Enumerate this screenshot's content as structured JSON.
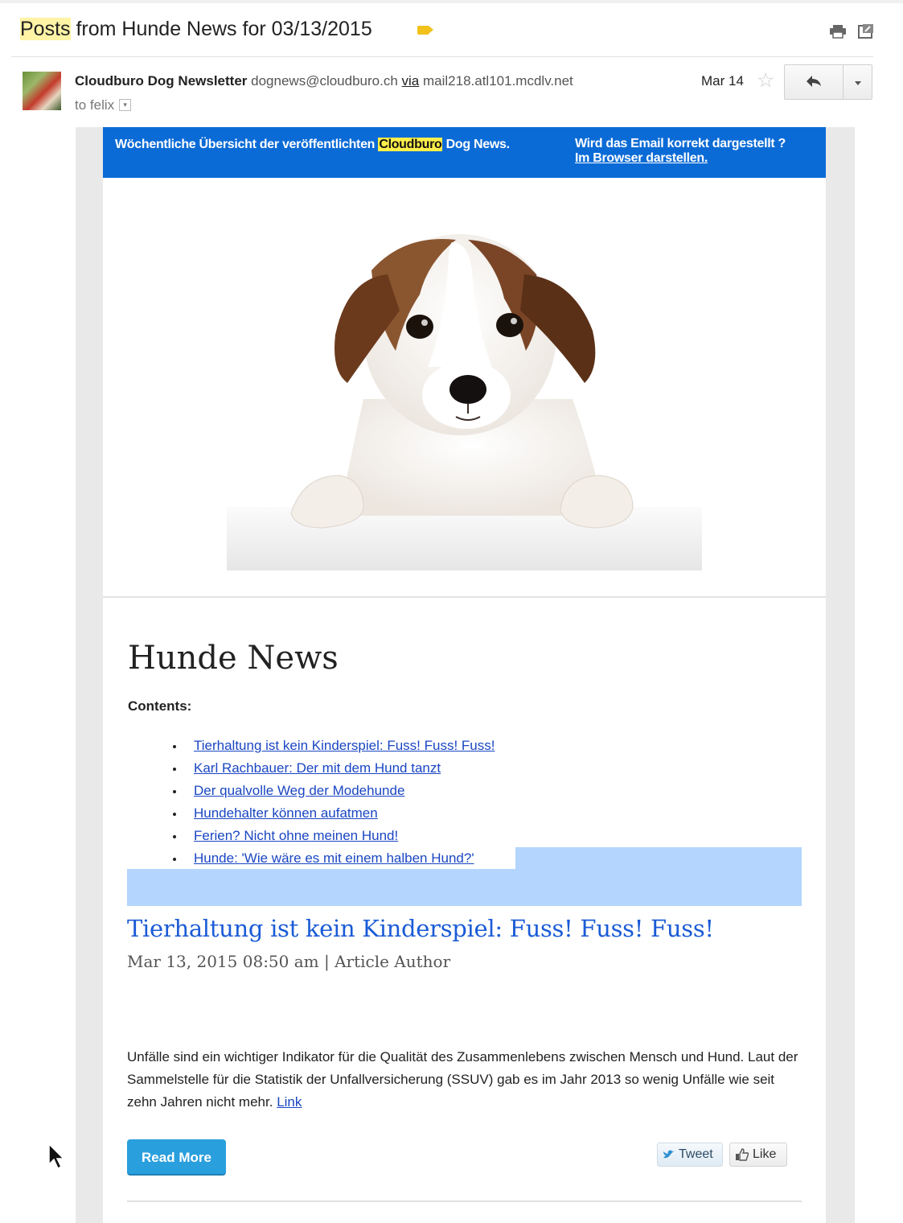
{
  "email": {
    "subject_highlight": "Posts",
    "subject_rest": " from Hunde News for 03/13/2015",
    "sender_name": "Cloudburo Dog Newsletter",
    "sender_address": "dognews@cloudburo.ch",
    "via_label": "via",
    "via_server": "mail218.atl101.mcdlv.net",
    "to_label": "to felix",
    "date": "Mar 14",
    "label_color": "#f2c21b"
  },
  "newsletter": {
    "header_left_pre": "Wöchentliche Übersicht der veröffentlichten ",
    "header_left_highlight": "Cloudburo",
    "header_left_post": " Dog News.",
    "header_right_line1": "Wird das Email korrekt dargestellt ?",
    "header_right_link": "Im Browser darstellen.",
    "header_color": "#0b6bd6",
    "title": "Hunde News",
    "contents_label": "Contents:",
    "toc": [
      "Tierhaltung ist kein Kinderspiel: Fuss! Fuss! Fuss!",
      "Karl Rachbauer: Der mit dem Hund tanzt",
      "Der qualvolle Weg der Modehunde",
      "Hundehalter können aufatmen",
      "Ferien? Nicht ohne meinen Hund!",
      "Hunde: 'Wie wäre es mit einem halben Hund?'"
    ],
    "article": {
      "title": "Tierhaltung ist kein Kinderspiel: Fuss! Fuss! Fuss!",
      "meta": "Mar 13, 2015 08:50 am | Article Author",
      "body": "Unfälle sind ein wichtiger Indikator für die Qualität des Zusammenlebens zwischen Mensch und Hund. Laut der Sammelstelle für die Statistik der Unfallversicherung (SSUV) gab es im Jahr 2013 so wenig Unfälle wie seit zehn Jahren nicht mehr.",
      "link_label": "Link",
      "read_more": "Read More",
      "tweet": "Tweet",
      "like": "Like"
    }
  }
}
